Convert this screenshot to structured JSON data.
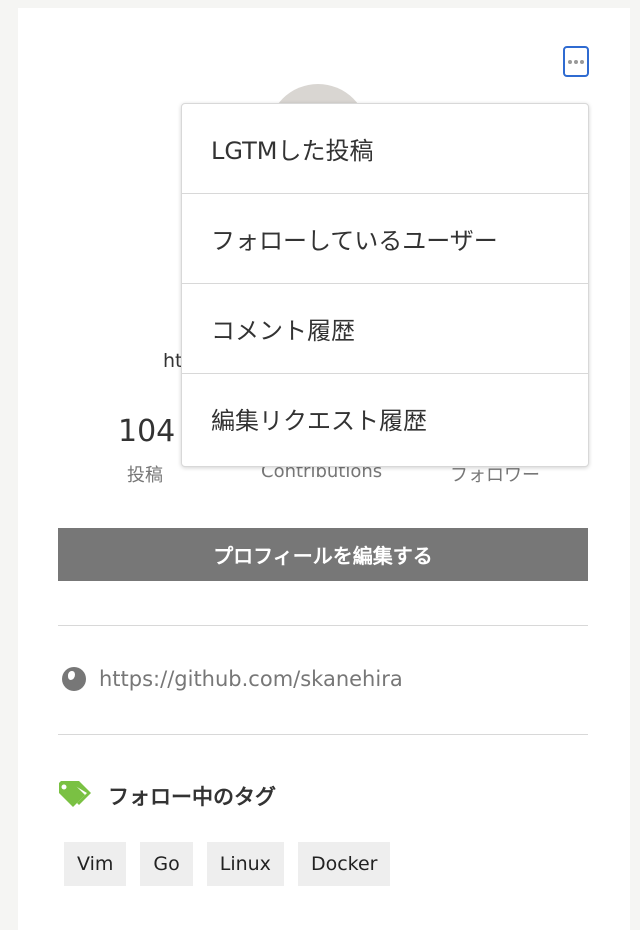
{
  "profile": {
    "url_fragment": "ht",
    "stats": {
      "posts_count": "104",
      "posts_label": "投稿",
      "contributions_label": "Contributions",
      "followers_label": "フォロワー"
    },
    "edit_button_label": "プロフィールを編集する",
    "website": "https://github.com/skanehira"
  },
  "icons": {
    "more": "ellipsis-icon",
    "globe": "globe-icon",
    "tags": "tags-icon"
  },
  "colors": {
    "tag_icon": "#7ac143",
    "focus_ring": "#2f6bd1",
    "edit_button": "#777777"
  },
  "following_tags": {
    "title": "フォロー中のタグ",
    "items": [
      "Vim",
      "Go",
      "Linux",
      "Docker"
    ]
  },
  "menu": {
    "items": [
      "LGTMした投稿",
      "フォローしているユーザー",
      "コメント履歴",
      "編集リクエスト履歴"
    ]
  }
}
